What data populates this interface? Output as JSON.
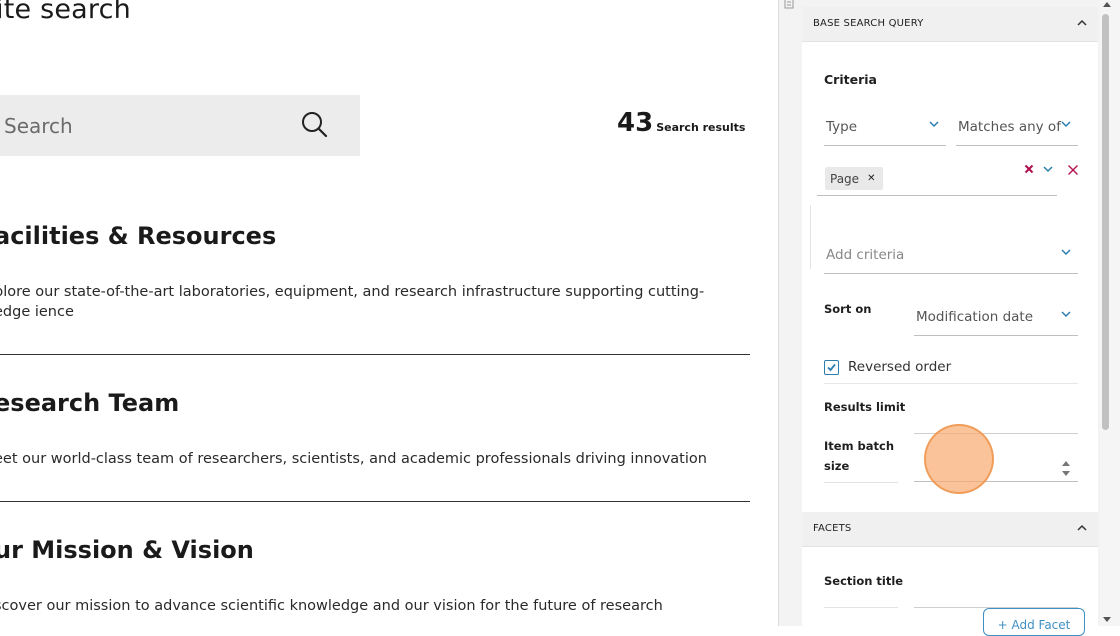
{
  "page": {
    "title": "ite search",
    "search": {
      "placeholder": "Search"
    },
    "results": {
      "count": "43",
      "label": "Search results"
    },
    "items": [
      {
        "title": "acilities & Resources",
        "desc": "plore our state-of-the-art laboratories, equipment, and research infrastructure supporting cutting-edge ience"
      },
      {
        "title": "esearch Team",
        "desc": "eet our world-class team of researchers, scientists, and academic professionals driving innovation"
      },
      {
        "title": "ur Mission & Vision",
        "desc": "scover our mission to advance scientific knowledge and our vision for the future of research"
      }
    ]
  },
  "panel": {
    "base_query": {
      "title": "BASE SEARCH QUERY",
      "criteria_label": "Criteria",
      "type_label": "Type",
      "match_label": "Matches any of",
      "chip_label": "Page",
      "add_criteria": "Add criteria",
      "sort_label": "Sort on",
      "sort_value": "Modification date",
      "reversed_label": "Reversed order",
      "reversed_checked": true,
      "results_limit_label": "Results limit",
      "batch_label": "Item batch size"
    },
    "facets": {
      "title": "FACETS",
      "section_title_label": "Section title",
      "add_facet_label": "+ Add Facet"
    }
  },
  "colors": {
    "accent": "#2a7fb0",
    "remove": "#b0104e",
    "bg_panel": "#f3f3f3"
  }
}
